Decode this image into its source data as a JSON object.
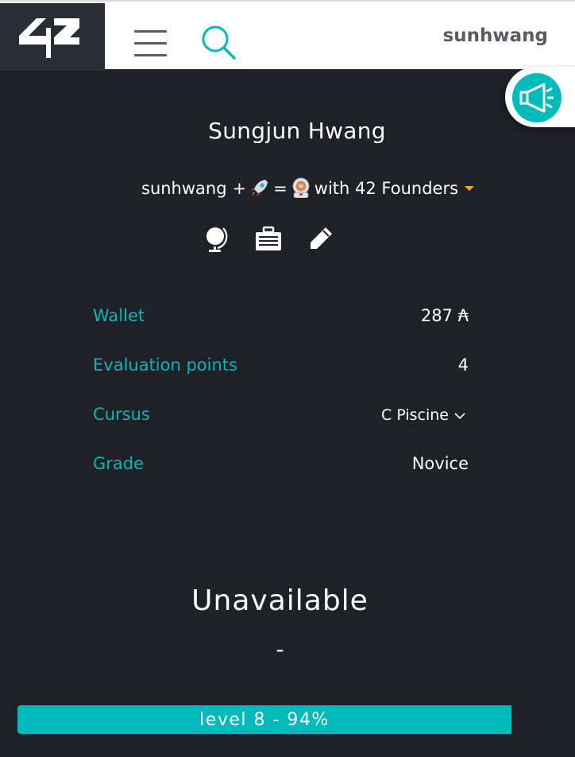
{
  "header": {
    "logo_text": "42",
    "username": "sunhwang"
  },
  "profile": {
    "full_name": "Sungjun Hwang",
    "title": {
      "login": "sunhwang",
      "plus": "+",
      "equals": "=",
      "suffix": "with 42 Founders"
    }
  },
  "info": {
    "wallet_label": "Wallet",
    "wallet_value": "287 ₳",
    "eval_label": "Evaluation points",
    "eval_value": "4",
    "cursus_label": "Cursus",
    "cursus_value": "C Piscine",
    "grade_label": "Grade",
    "grade_value": "Novice"
  },
  "status": {
    "title": "Unavailable",
    "subtitle": "-"
  },
  "level": {
    "text": "level 8 - 94%",
    "progress": 1.0
  },
  "colors": {
    "accent": "#00babc",
    "background": "#202027",
    "caret": "#f5a623"
  }
}
